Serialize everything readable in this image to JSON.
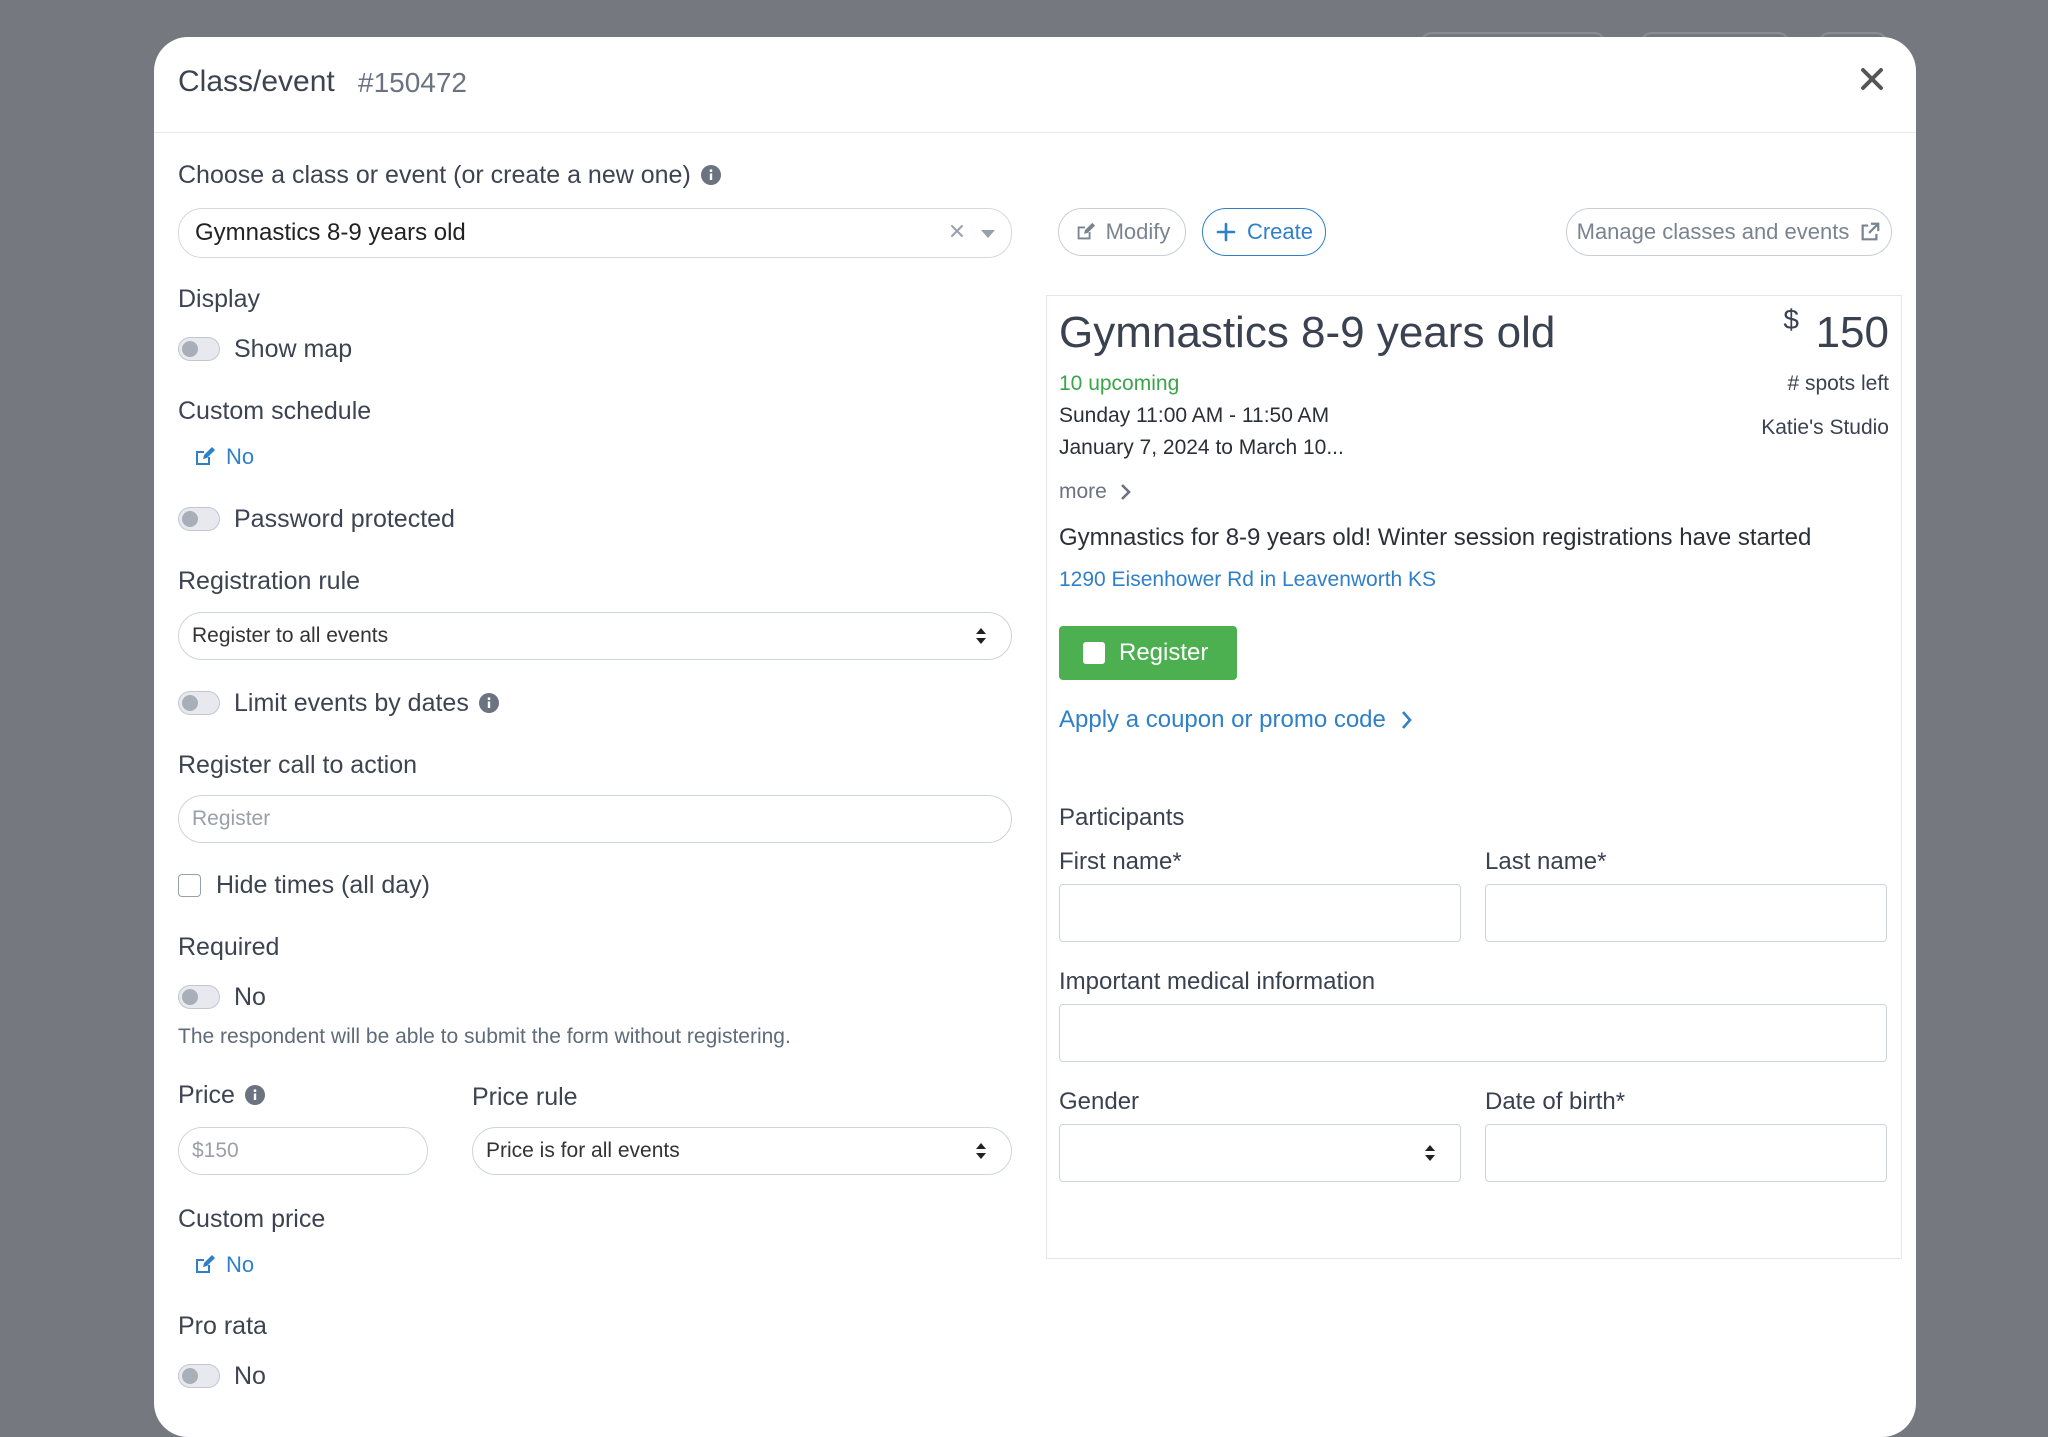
{
  "modal": {
    "title": "Class/event",
    "id": "#150472"
  },
  "form": {
    "choose_label": "Choose a class or event (or create a new one)",
    "selected_class": "Gymnastics 8-9 years old",
    "display_label": "Display",
    "show_map_label": "Show map",
    "custom_schedule_label": "Custom schedule",
    "custom_schedule_value": "No",
    "password_label": "Password protected",
    "registration_rule_label": "Registration rule",
    "registration_rule_value": "Register to all events",
    "limit_dates_label": "Limit events by dates",
    "cta_label": "Register call to action",
    "cta_placeholder": "Register",
    "hide_times_label": "Hide times (all day)",
    "required_label": "Required",
    "required_value": "No",
    "required_help": "The respondent will be able to submit the form without registering.",
    "price_label": "Price",
    "price_placeholder": "$150",
    "price_rule_label": "Price rule",
    "price_rule_value": "Price is for all events",
    "custom_price_label": "Custom price",
    "custom_price_value": "No",
    "pro_rata_label": "Pro rata",
    "pro_rata_value": "No"
  },
  "actions": {
    "modify": "Modify",
    "create": "Create",
    "manage": "Manage classes and events"
  },
  "preview": {
    "title": "Gymnastics 8-9 years old",
    "currency": "$",
    "price": "150",
    "upcoming": "10 upcoming",
    "spots": "# spots left",
    "schedule": "Sunday 11:00 AM - 11:50 AM",
    "dates": "January 7, 2024 to March 10...",
    "studio": "Katie's Studio",
    "more": "more",
    "description": "Gymnastics for 8-9 years old! Winter session registrations have started",
    "address": "1290 Eisenhower Rd in Leavenworth KS",
    "register": "Register",
    "coupon": "Apply a coupon or promo code",
    "participants": "Participants",
    "first_name": "First name*",
    "last_name": "Last name*",
    "medical": "Important medical information",
    "gender": "Gender",
    "dob": "Date of birth*"
  },
  "colors": {
    "accent": "#2f80c9",
    "success": "#4caf50",
    "upcoming": "#3aa44a",
    "backdrop": "#75787e"
  }
}
